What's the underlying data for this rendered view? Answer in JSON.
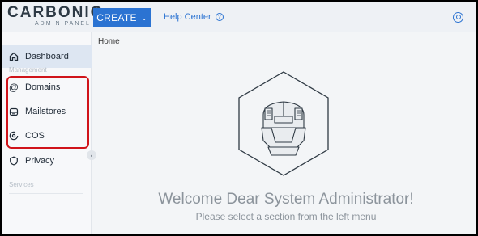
{
  "brand": {
    "name": "CARBONIO",
    "subtitle": "ADMIN PANEL"
  },
  "topbar": {
    "create_label": "CREATE",
    "help_label": "Help Center"
  },
  "sidebar": {
    "dashboard": "Dashboard",
    "management_label": "Management",
    "items": [
      {
        "label": "Domains",
        "icon": "at-icon"
      },
      {
        "label": "Mailstores",
        "icon": "mailstore-icon"
      },
      {
        "label": "COS",
        "icon": "cos-icon"
      },
      {
        "label": "Privacy",
        "icon": "shield-icon"
      }
    ],
    "services_label": "Services"
  },
  "main": {
    "breadcrumb": "Home",
    "welcome": "Welcome Dear System Administrator!",
    "subtitle": "Please select a section from the left menu"
  },
  "colors": {
    "accent": "#2b73d2",
    "highlight": "#d0141a"
  }
}
